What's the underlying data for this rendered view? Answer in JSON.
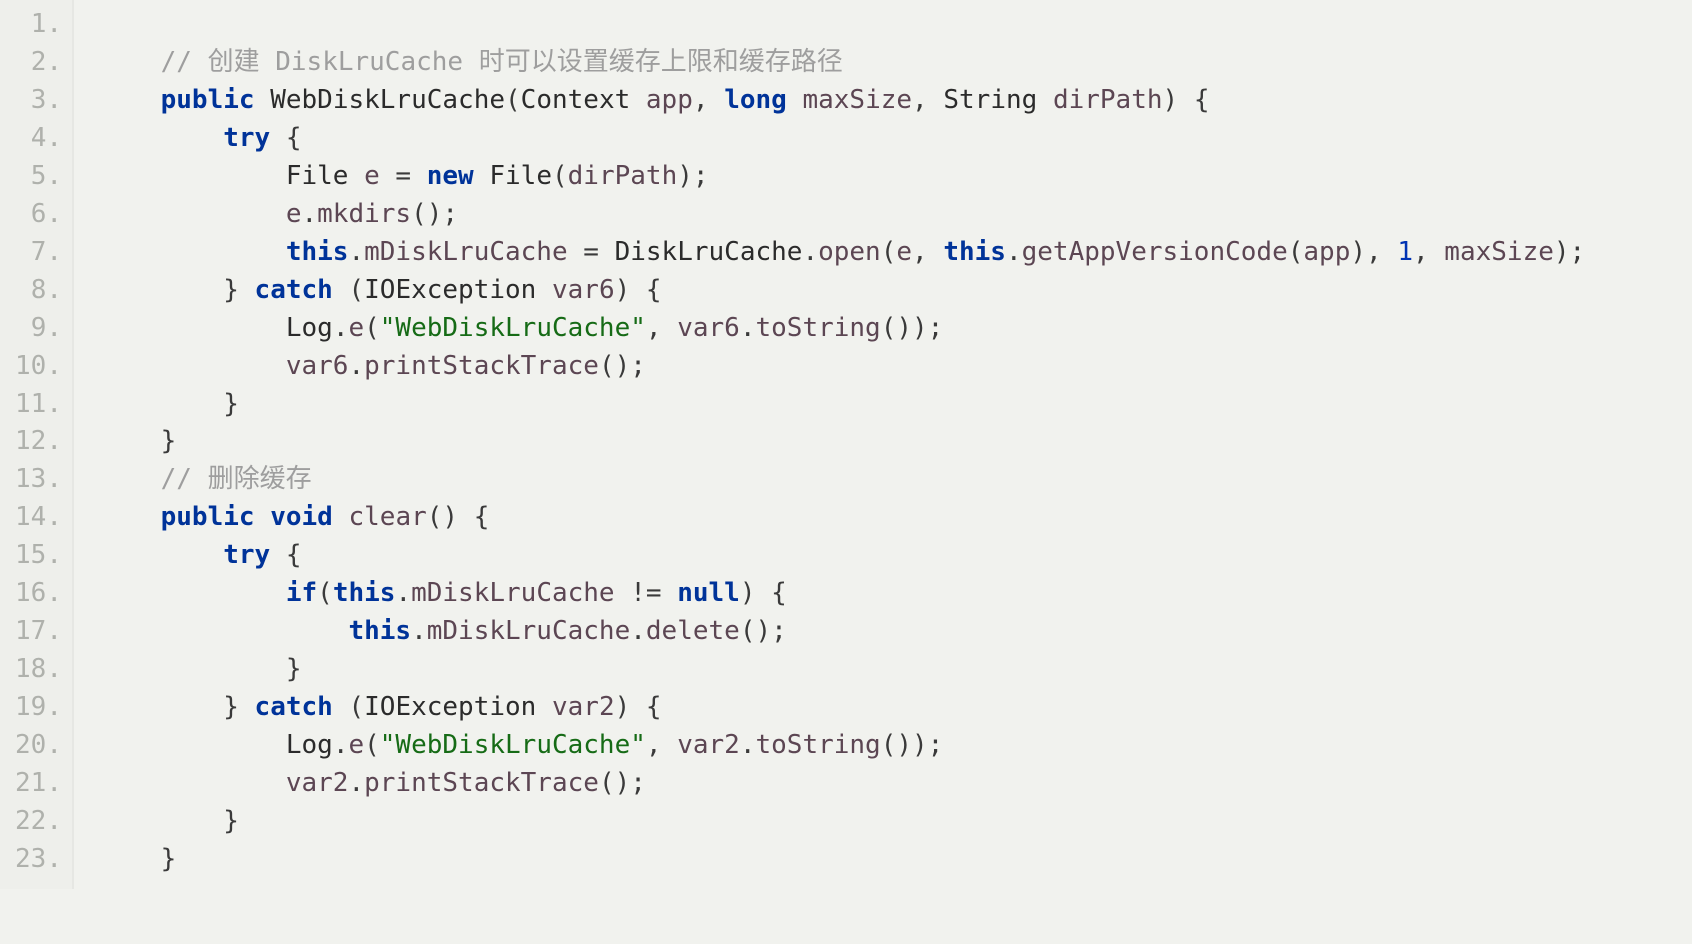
{
  "lineCount": 23,
  "lines": {
    "l1": "",
    "l2": {
      "indent": "    ",
      "tokens": [
        [
          "cmt",
          "// 创建 DiskLruCache 时可以设置缓存上限和缓存路径"
        ]
      ]
    },
    "l3": {
      "indent": "    ",
      "tokens": [
        [
          "kw",
          "public"
        ],
        [
          "sp",
          " "
        ],
        [
          "type",
          "WebDiskLruCache"
        ],
        [
          "pun",
          "("
        ],
        [
          "type",
          "Context"
        ],
        [
          "sp",
          " "
        ],
        [
          "ident",
          "app"
        ],
        [
          "pun",
          ", "
        ],
        [
          "kw",
          "long"
        ],
        [
          "sp",
          " "
        ],
        [
          "ident",
          "maxSize"
        ],
        [
          "pun",
          ", "
        ],
        [
          "type",
          "String"
        ],
        [
          "sp",
          " "
        ],
        [
          "ident",
          "dirPath"
        ],
        [
          "pun",
          ") {"
        ]
      ]
    },
    "l4": {
      "indent": "        ",
      "tokens": [
        [
          "kw",
          "try"
        ],
        [
          "pun",
          " {"
        ]
      ]
    },
    "l5": {
      "indent": "            ",
      "tokens": [
        [
          "type",
          "File"
        ],
        [
          "sp",
          " "
        ],
        [
          "ident",
          "e"
        ],
        [
          "pun",
          " = "
        ],
        [
          "kw",
          "new"
        ],
        [
          "sp",
          " "
        ],
        [
          "type",
          "File"
        ],
        [
          "pun",
          "("
        ],
        [
          "ident",
          "dirPath"
        ],
        [
          "pun",
          ");"
        ]
      ]
    },
    "l6": {
      "indent": "            ",
      "tokens": [
        [
          "ident",
          "e"
        ],
        [
          "pun",
          "."
        ],
        [
          "ident",
          "mkdirs"
        ],
        [
          "pun",
          "();"
        ]
      ]
    },
    "l7": {
      "indent": "            ",
      "tokens": [
        [
          "kw",
          "this"
        ],
        [
          "pun",
          "."
        ],
        [
          "ident",
          "mDiskLruCache"
        ],
        [
          "pun",
          " = "
        ],
        [
          "type",
          "DiskLruCache"
        ],
        [
          "pun",
          "."
        ],
        [
          "ident",
          "open"
        ],
        [
          "pun",
          "("
        ],
        [
          "ident",
          "e"
        ],
        [
          "pun",
          ", "
        ],
        [
          "kw",
          "this"
        ],
        [
          "pun",
          "."
        ],
        [
          "ident",
          "getAppVersionCode"
        ],
        [
          "pun",
          "("
        ],
        [
          "ident",
          "app"
        ],
        [
          "pun",
          "), "
        ],
        [
          "num",
          "1"
        ],
        [
          "pun",
          ", "
        ],
        [
          "ident",
          "maxSize"
        ],
        [
          "pun",
          ");"
        ]
      ]
    },
    "l8": {
      "indent": "        ",
      "tokens": [
        [
          "pun",
          "} "
        ],
        [
          "kw",
          "catch"
        ],
        [
          "pun",
          " ("
        ],
        [
          "type",
          "IOException"
        ],
        [
          "sp",
          " "
        ],
        [
          "ident",
          "var6"
        ],
        [
          "pun",
          ") {"
        ]
      ]
    },
    "l9": {
      "indent": "            ",
      "tokens": [
        [
          "type",
          "Log"
        ],
        [
          "pun",
          "."
        ],
        [
          "ident",
          "e"
        ],
        [
          "pun",
          "("
        ],
        [
          "str",
          "\"WebDiskLruCache\""
        ],
        [
          "pun",
          ", "
        ],
        [
          "ident",
          "var6"
        ],
        [
          "pun",
          "."
        ],
        [
          "ident",
          "toString"
        ],
        [
          "pun",
          "());"
        ]
      ]
    },
    "l10": {
      "indent": "            ",
      "tokens": [
        [
          "ident",
          "var6"
        ],
        [
          "pun",
          "."
        ],
        [
          "ident",
          "printStackTrace"
        ],
        [
          "pun",
          "();"
        ]
      ]
    },
    "l11": {
      "indent": "        ",
      "tokens": [
        [
          "pun",
          "}"
        ]
      ]
    },
    "l12": {
      "indent": "    ",
      "tokens": [
        [
          "pun",
          "}"
        ]
      ]
    },
    "l13": {
      "indent": "    ",
      "tokens": [
        [
          "cmt",
          "// 删除缓存"
        ]
      ]
    },
    "l14": {
      "indent": "    ",
      "tokens": [
        [
          "kw",
          "public"
        ],
        [
          "sp",
          " "
        ],
        [
          "kw",
          "void"
        ],
        [
          "sp",
          " "
        ],
        [
          "ident",
          "clear"
        ],
        [
          "pun",
          "() {"
        ]
      ]
    },
    "l15": {
      "indent": "        ",
      "tokens": [
        [
          "kw",
          "try"
        ],
        [
          "pun",
          " {"
        ]
      ]
    },
    "l16": {
      "indent": "            ",
      "tokens": [
        [
          "kw",
          "if"
        ],
        [
          "pun",
          "("
        ],
        [
          "kw",
          "this"
        ],
        [
          "pun",
          "."
        ],
        [
          "ident",
          "mDiskLruCache"
        ],
        [
          "pun",
          " != "
        ],
        [
          "null",
          "null"
        ],
        [
          "pun",
          ") {"
        ]
      ]
    },
    "l17": {
      "indent": "                ",
      "tokens": [
        [
          "kw",
          "this"
        ],
        [
          "pun",
          "."
        ],
        [
          "ident",
          "mDiskLruCache"
        ],
        [
          "pun",
          "."
        ],
        [
          "ident",
          "delete"
        ],
        [
          "pun",
          "();"
        ]
      ]
    },
    "l18": {
      "indent": "            ",
      "tokens": [
        [
          "pun",
          "}"
        ]
      ]
    },
    "l19": {
      "indent": "        ",
      "tokens": [
        [
          "pun",
          "} "
        ],
        [
          "kw",
          "catch"
        ],
        [
          "pun",
          " ("
        ],
        [
          "type",
          "IOException"
        ],
        [
          "sp",
          " "
        ],
        [
          "ident",
          "var2"
        ],
        [
          "pun",
          ") {"
        ]
      ]
    },
    "l20": {
      "indent": "            ",
      "tokens": [
        [
          "type",
          "Log"
        ],
        [
          "pun",
          "."
        ],
        [
          "ident",
          "e"
        ],
        [
          "pun",
          "("
        ],
        [
          "str",
          "\"WebDiskLruCache\""
        ],
        [
          "pun",
          ", "
        ],
        [
          "ident",
          "var2"
        ],
        [
          "pun",
          "."
        ],
        [
          "ident",
          "toString"
        ],
        [
          "pun",
          "());"
        ]
      ]
    },
    "l21": {
      "indent": "            ",
      "tokens": [
        [
          "ident",
          "var2"
        ],
        [
          "pun",
          "."
        ],
        [
          "ident",
          "printStackTrace"
        ],
        [
          "pun",
          "();"
        ]
      ]
    },
    "l22": {
      "indent": "        ",
      "tokens": [
        [
          "pun",
          "}"
        ]
      ]
    },
    "l23": {
      "indent": "    ",
      "tokens": [
        [
          "pun",
          "}"
        ]
      ]
    }
  }
}
